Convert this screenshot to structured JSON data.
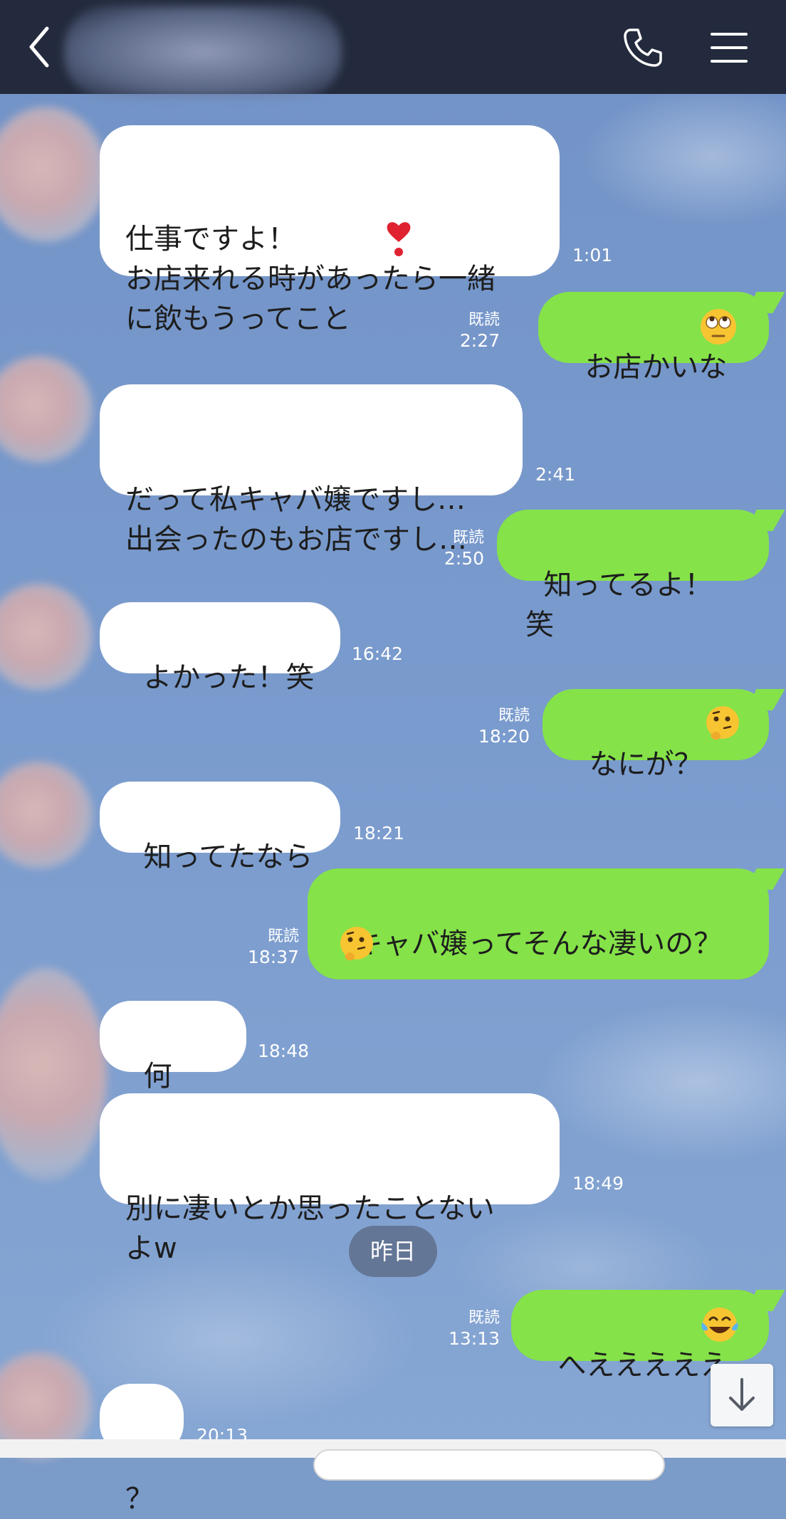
{
  "header": {
    "back_icon": "chevron-left-icon",
    "call_icon": "phone-icon",
    "menu_icon": "hamburger-menu-icon"
  },
  "messages": [
    {
      "side": "in",
      "text": "仕事ですよ！\nお店来れる時があったら一緒\nに飲もうってこと",
      "emoji": "heavy-heart-exclamation",
      "time": "1:01"
    },
    {
      "side": "out",
      "text": "お店かいな",
      "emoji": "face-with-rolling-eyes",
      "read": "既読",
      "time": "2:27"
    },
    {
      "side": "in",
      "text": "だって私キャバ嬢ですし…\n出会ったのもお店ですし…",
      "time": "2:41"
    },
    {
      "side": "out",
      "text": "知ってるよ！笑",
      "read": "既読",
      "time": "2:50"
    },
    {
      "side": "in",
      "text": "よかった！笑",
      "time": "16:42"
    },
    {
      "side": "out",
      "text": "なにが？",
      "emoji": "thinking-face",
      "read": "既読",
      "time": "18:20"
    },
    {
      "side": "in",
      "text": "知ってたなら",
      "time": "18:21"
    },
    {
      "side": "out",
      "text": "キャバ嬢ってそんな凄いの？",
      "emoji": "thinking-face",
      "read": "既読",
      "time": "18:37"
    },
    {
      "side": "in",
      "text": "何が？",
      "time": "18:48"
    },
    {
      "side": "in",
      "text": "別に凄いとか思ったことない\nよw",
      "time": "18:49"
    },
    {
      "side": "out",
      "text": "へえええええ",
      "emoji": "face-with-tears-of-joy",
      "read": "既読",
      "time": "13:13"
    },
    {
      "side": "in",
      "text": "？",
      "time": "20:13"
    }
  ],
  "date_divider": "昨日",
  "scroll_icon": "arrow-down-icon",
  "colors": {
    "header_bg": "#232a3d",
    "bubble_out": "#85e249",
    "bubble_in": "#ffffff",
    "chat_bg": "#7b9bc9"
  }
}
